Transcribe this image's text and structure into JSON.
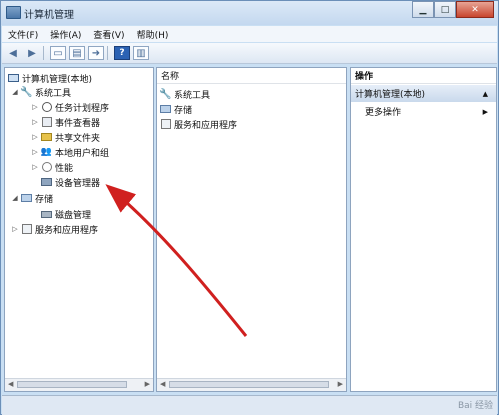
{
  "window": {
    "title": "计算机管理"
  },
  "menubar": {
    "items": [
      "文件(F)",
      "操作(A)",
      "查看(V)",
      "帮助(H)"
    ]
  },
  "tree": {
    "root": "计算机管理(本地)",
    "system_tools": "系统工具",
    "task_scheduler": "任务计划程序",
    "event_viewer": "事件查看器",
    "shared_folders": "共享文件夹",
    "local_users": "本地用户和组",
    "performance": "性能",
    "device_manager": "设备管理器",
    "storage": "存储",
    "disk_management": "磁盘管理",
    "services_apps": "服务和应用程序"
  },
  "list": {
    "header": "名称",
    "items": [
      "系统工具",
      "存储",
      "服务和应用程序"
    ]
  },
  "actions": {
    "header": "操作",
    "section": "计算机管理(本地)",
    "more": "更多操作"
  },
  "watermark": "Bai 经验"
}
